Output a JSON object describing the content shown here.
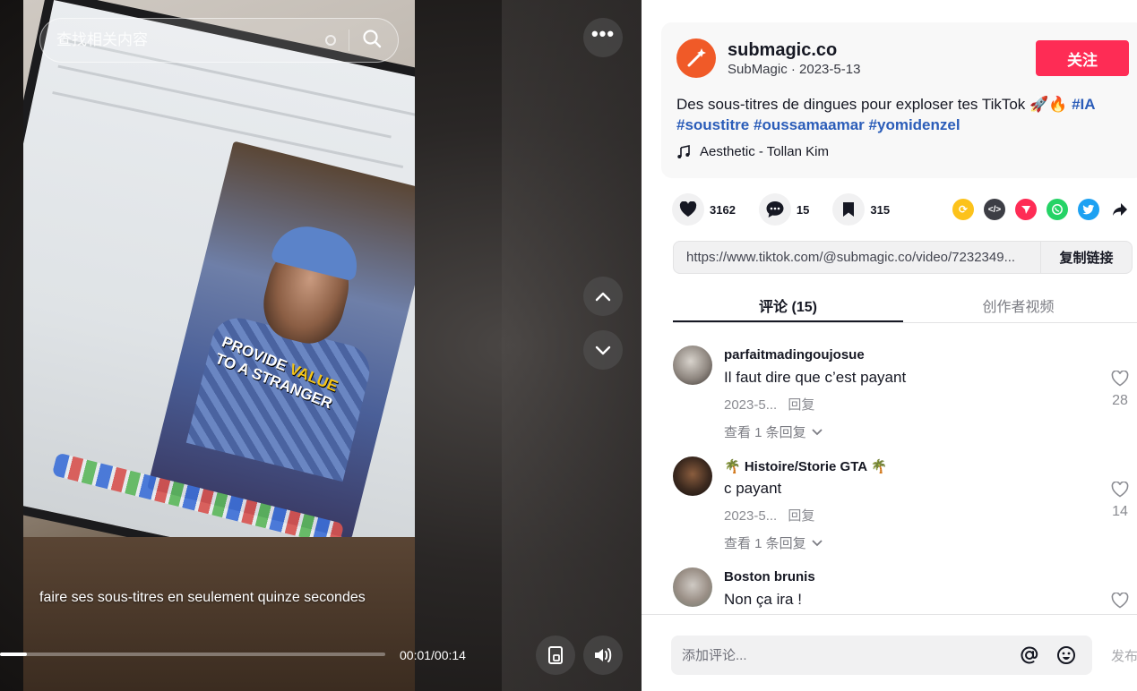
{
  "search": {
    "placeholder": "查找相关内容"
  },
  "video": {
    "caption": "faire ses sous-titres en seulement quinze secondes",
    "time": "00:01/00:14",
    "progress": 0.07,
    "overlay_text_1": "PROVIDE ",
    "overlay_text_2": "VALUE",
    "overlay_text_3": "TO A STRANGER"
  },
  "author": {
    "username": "submagic.co",
    "subline": "SubMagic · 2023-5-13",
    "follow_label": "关注"
  },
  "description": {
    "text": "Des sous-titres de dingues pour exploser tes TikTok 🚀🔥 ",
    "tags": [
      "#IA",
      "#soustitre",
      "#oussamaamar",
      "#yomidenzel"
    ]
  },
  "music": {
    "title": "Aesthetic - Tollan Kim"
  },
  "stats": {
    "likes": "3162",
    "comments": "15",
    "saves": "315"
  },
  "share_icons": [
    {
      "name": "repost-icon",
      "color": "#fcc21b"
    },
    {
      "name": "embed-icon",
      "color": "#3d3e45"
    },
    {
      "name": "send-to-friends-icon",
      "color": "#fe2c55"
    },
    {
      "name": "whatsapp-icon",
      "color": "#25d366"
    },
    {
      "name": "twitter-icon",
      "color": "#1da1f2"
    }
  ],
  "link": {
    "url": "https://www.tiktok.com/@submagic.co/video/7232349...",
    "copy_label": "复制链接"
  },
  "tabs": [
    {
      "label": "评论 (15)",
      "active": true
    },
    {
      "label": "创作者视频",
      "active": false
    }
  ],
  "comments": [
    {
      "user": "parfaitmadingoujosue",
      "text": "Il faut dire que c’est payant",
      "date": "2023-5...",
      "reply": "回复",
      "view_replies": "查看 1 条回复",
      "likes": "28"
    },
    {
      "user": "🌴 Histoire/Storie GTA 🌴",
      "text": "c payant",
      "date": "2023-5...",
      "reply": "回复",
      "view_replies": "查看 1 条回复",
      "likes": "14"
    },
    {
      "user": "Boston brunis",
      "text": "Non ça ira !",
      "date": "",
      "reply": "",
      "view_replies": "",
      "likes": ""
    }
  ],
  "footer": {
    "input_placeholder": "添加评论...",
    "post_label": "发布"
  },
  "colors": {
    "accent": "#fe2c55",
    "hashtag": "#2b5db9",
    "brand": "#f05a28"
  }
}
